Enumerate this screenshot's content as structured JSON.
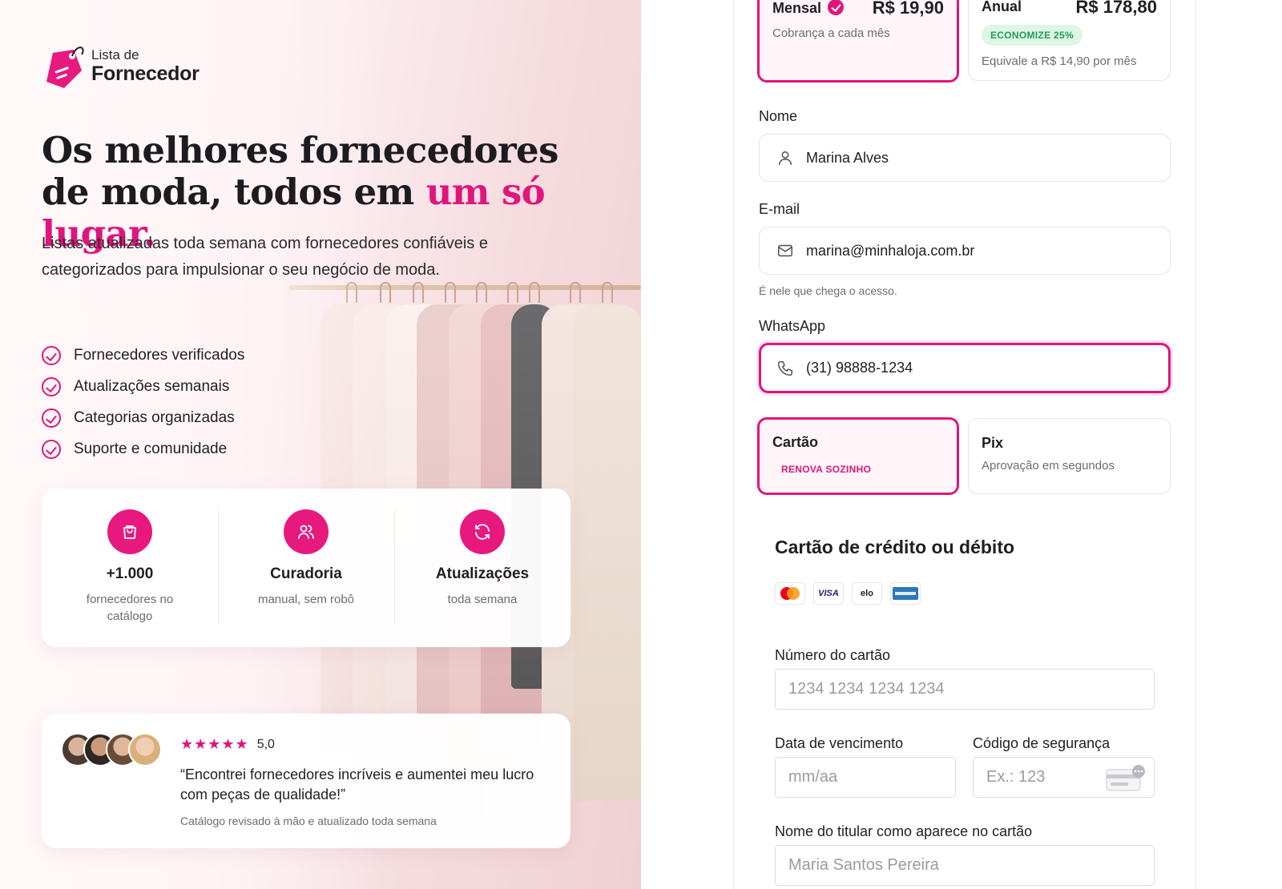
{
  "brand": {
    "line1": "Lista de",
    "line2": "Fornecedor"
  },
  "hero": {
    "headline_part1": "Os melhores fornecedores de moda, todos em ",
    "headline_accent": "um só lugar.",
    "subtitle": "Listas atualizadas toda semana com fornecedores confiáveis e categorizados para impulsionar o seu negócio de moda.",
    "features": [
      "Fornecedores verificados",
      "Atualizações semanais",
      "Categorias organizadas",
      "Suporte e comunidade"
    ]
  },
  "stats": [
    {
      "icon": "shopping-bag-icon",
      "title": "+1.000",
      "sub": "fornecedores no catálogo"
    },
    {
      "icon": "users-icon",
      "title": "Curadoria",
      "sub": "manual, sem robô"
    },
    {
      "icon": "refresh-icon",
      "title": "Atualizações",
      "sub": "toda semana"
    }
  ],
  "review": {
    "rating": "5,0",
    "stars": "★★★★★",
    "quote": "“Encontrei fornecedores incríveis e aumentei meu lucro com peças de qualidade!”",
    "footer": "Catálogo revisado à mão e atualizado toda semana"
  },
  "plans": {
    "monthly": {
      "title": "Mensal",
      "price": "R$ 19,90",
      "sub": "Cobrança a cada mês",
      "selected": true
    },
    "yearly": {
      "title": "Anual",
      "price": "R$ 178,80",
      "badge": "ECONOMIZE 25%",
      "sub": "Equivale a R$ 14,90 por mês",
      "selected": false
    }
  },
  "form": {
    "name_label": "Nome",
    "name_value": "Marina Alves",
    "email_label": "E-mail",
    "email_value": "marina@minhaloja.com.br",
    "email_hint": "É nele que chega o acesso.",
    "whatsapp_label": "WhatsApp",
    "whatsapp_value": "(31) 98888-1234"
  },
  "payment": {
    "card": {
      "title": "Cartão",
      "badge": "RENOVA SOZINHO",
      "selected": true
    },
    "pix": {
      "title": "Pix",
      "sub": "Aprovação em segundos",
      "selected": false
    }
  },
  "card_form": {
    "title": "Cartão de crédito ou débito",
    "brands": [
      "mastercard",
      "VISA",
      "elo",
      "AMERICAN EXPRESS"
    ],
    "number_label": "Número do cartão",
    "number_placeholder": "1234 1234 1234 1234",
    "expiry_label": "Data de vencimento",
    "expiry_placeholder": "mm/aa",
    "cvc_label": "Código de segurança",
    "cvc_placeholder": "Ex.: 123",
    "holder_label": "Nome do titular como aparece no cartão",
    "holder_placeholder": "Maria Santos Pereira"
  },
  "colors": {
    "accent": "#e0157b",
    "green": "#1f9d55",
    "text": "#1f1f23",
    "muted": "#6b6b73"
  }
}
